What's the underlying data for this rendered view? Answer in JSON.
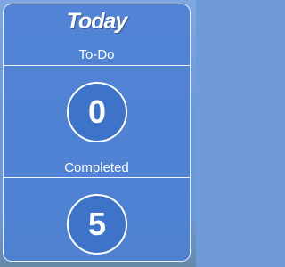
{
  "widget": {
    "logo_text": "Today",
    "todo": {
      "label": "To-Do",
      "count": "0"
    },
    "completed": {
      "label": "Completed",
      "count": "5"
    }
  },
  "colors": {
    "widget_background": "#4e80d2",
    "circle_fill": "#3d73c9",
    "text": "#ffffff"
  }
}
